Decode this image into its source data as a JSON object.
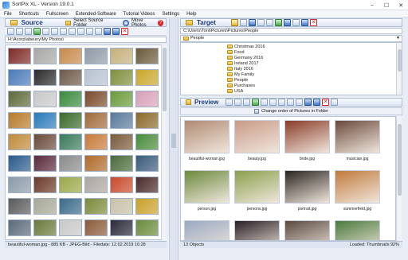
{
  "window": {
    "title": "SortPix XL - Version 19.0.1"
  },
  "menu": [
    "File",
    "Shortcuts",
    "Fullscreen",
    "Extended-Software",
    "Tutorial Videos",
    "Settings",
    "Help"
  ],
  "source": {
    "title": "Source",
    "select_label": "Select Source Folder",
    "move_label": "Move Photos",
    "path": "H:\\Acorp\\abeuny\\My Photos\\"
  },
  "target": {
    "title": "Target",
    "path": "C:\\Users\\Toni\\Pictures\\Pictures\\People",
    "dropdown_value": "People",
    "folders": [
      "Christmas 2016",
      "Food",
      "Germany 2016",
      "Ireland 2017",
      "Italy 2016",
      "My Family",
      "People",
      "Purchases",
      "USA"
    ]
  },
  "preview": {
    "title": "Preview",
    "change_order_label": "Change order of Pictures in Folder",
    "items": [
      {
        "label": "beautiful-woman.jpg",
        "color": "#b08a73"
      },
      {
        "label": "beauty.jpg",
        "color": "#c89a86"
      },
      {
        "label": "bride.jpg",
        "color": "#8a3c28"
      },
      {
        "label": "musician.jpg",
        "color": "#6a4a3c"
      },
      {
        "label": "person.jpg",
        "color": "#6b8a3c"
      },
      {
        "label": "persons.jpg",
        "color": "#8aa04c"
      },
      {
        "label": "portrait.jpg",
        "color": "#2a2420"
      },
      {
        "label": "summerfield.jpg",
        "color": "#c07a3c"
      },
      {
        "label": "",
        "color": "#9aa9c2"
      },
      {
        "label": "",
        "color": "#2a2026"
      },
      {
        "label": "",
        "color": "#5a4a40"
      },
      {
        "label": "",
        "color": "#4a7a3c"
      }
    ]
  },
  "source_thumbs": [
    "#7e2a26",
    "#a7a8a6",
    "#c7894a",
    "#8f9aa6",
    "#c4b07a",
    "#6a5a3a",
    "#4a7ab8",
    "#2b2b2b",
    "#6d5a47",
    "#b7c2d0",
    "#7e8f3c",
    "#c8a62a",
    "#5d6a3a",
    "#c8c8c8",
    "#3a8a3c",
    "#7a4a2a",
    "#6a9a3a",
    "#d8a0b8",
    "#b87a2a",
    "#2a7ab8",
    "#3a6a2a",
    "#a06a3a",
    "#5a7a9a",
    "#8a6a2a",
    "#c08a3a",
    "#6a4a3a",
    "#3a7a5a",
    "#c87a3a",
    "#7a5a3a",
    "#4a8a3a",
    "#2a5a8a",
    "#5a2a3a",
    "#8a8a8a",
    "#b06a2a",
    "#4a6a3a",
    "#3a5a7a",
    "#8a9aa8",
    "#6a3a2a",
    "#9aa848",
    "#aaa6a0",
    "#c84a2a",
    "#4a2a2a",
    "#5a5a5a",
    "#a8a896",
    "#3a6a8a",
    "#7a8a3a",
    "#c8c0a8",
    "#caa02a",
    "#5a6a7a",
    "#6a7a3a",
    "#c8c8c8",
    "#8a5a3a",
    "#2a2a3a",
    "#6a8a3a"
  ],
  "status_left": "beautiful-woman.jpg - 885 KB - JPEG-Bild - Filedate: 12.02.2019 16:28",
  "status_right_left": "13 Objects",
  "status_right_right": "Loaded: Thumbnails 92%"
}
